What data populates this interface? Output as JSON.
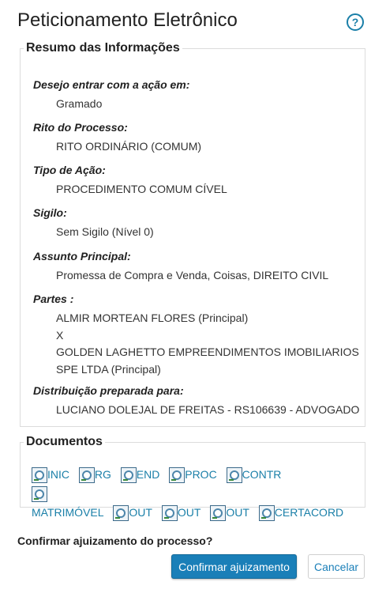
{
  "page": {
    "title": "Peticionamento Eletrônico",
    "help_icon": "help-circle-icon",
    "help_glyph": "?"
  },
  "resumo": {
    "legend": "Resumo das Informações",
    "fields": [
      {
        "label": "Desejo entrar com a ação em:",
        "lines": [
          "Gramado"
        ]
      },
      {
        "label": "Rito do Processo:",
        "lines": [
          "RITO ORDINÁRIO (COMUM)"
        ]
      },
      {
        "label": "Tipo de Ação:",
        "lines": [
          "PROCEDIMENTO COMUM CÍVEL"
        ]
      },
      {
        "label": "Sigilo:",
        "lines": [
          "Sem Sigilo (Nível 0)"
        ]
      },
      {
        "label": "Assunto Principal:",
        "lines": [
          "Promessa de Compra e Venda, Coisas, DIREITO CIVIL"
        ]
      },
      {
        "label": "Partes :",
        "lines": [
          "ALMIR MORTEAN FLORES (Principal)",
          "X",
          "GOLDEN LAGHETTO EMPREENDIMENTOS IMOBILIARIOS",
          "SPE LTDA (Principal)"
        ]
      },
      {
        "label": "Distribuição preparada para:",
        "lines": [
          "LUCIANO DOLEJAL DE FREITAS - RS106639 - ADVOGADO"
        ]
      }
    ]
  },
  "documentos": {
    "legend": "Documentos",
    "icon": "document-search-icon",
    "items": [
      "INIC",
      "RG",
      "END",
      "PROC",
      "CONTR",
      "MATRIMÓVEL",
      "OUT",
      "OUT",
      "OUT",
      "CERTACORD"
    ]
  },
  "confirm": {
    "question": "Confirmar ajuizamento do processo?",
    "confirm_label": "Confirmar ajuizamento",
    "cancel_label": "Cancelar"
  },
  "colors": {
    "accent": "#1a7fb8",
    "link": "#1a7fa8",
    "border": "#dcdcdc"
  }
}
